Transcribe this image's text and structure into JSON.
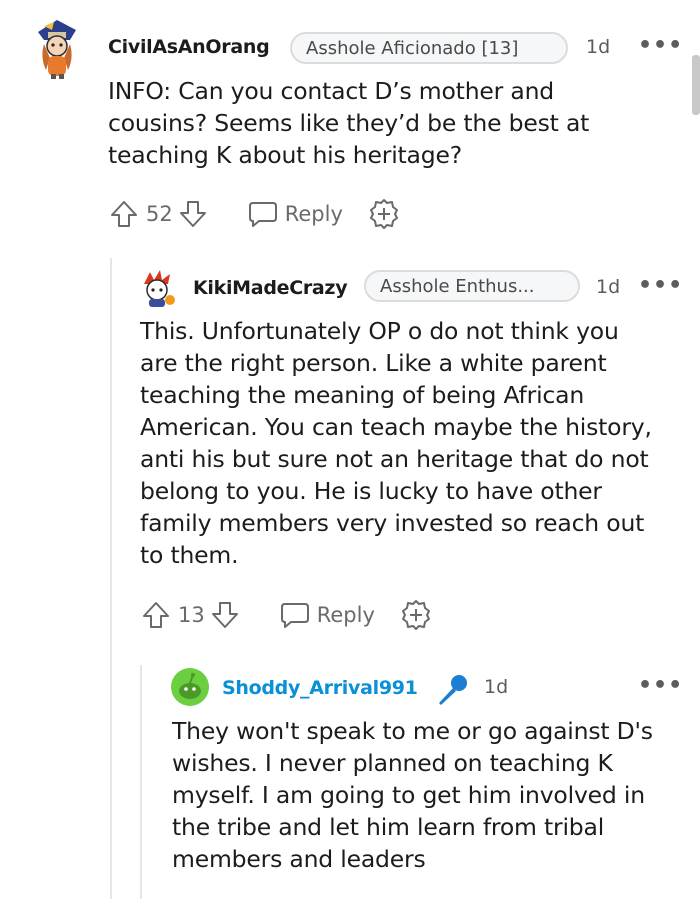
{
  "comments": [
    {
      "username": "CivilAsAnOrang",
      "flair": "Asshole Aficionado [13]",
      "time": "1d",
      "more": "•••",
      "lines": [
        "INFO: Can you contact D’s mother and",
        "cousins? Seems like they’d be the best at",
        "teaching K about his heritage?"
      ],
      "votes": "52",
      "reply_label": "Reply"
    },
    {
      "username": "KikiMadeCrazy",
      "flair": "Asshole Enthus...",
      "time": "1d",
      "more": "•••",
      "lines": [
        "This. Unfortunately OP o do not think you",
        "are the right person. Like a white parent",
        "teaching the meaning of being African",
        "American. You can teach maybe the history,",
        "anti his but sure not an heritage that do not",
        "belong to you. He is lucky to have other",
        "family members very invested so reach out",
        "to them."
      ],
      "votes": "13",
      "reply_label": "Reply"
    },
    {
      "username": "Shoddy_Arrival991",
      "time": "1d",
      "more": "•••",
      "lines": [
        "They won't speak to me or go against D's",
        "wishes. I never planned on teaching K",
        "myself. I am going to get him involved in",
        "the tribe and let him learn from tribal",
        "members and leaders"
      ]
    }
  ],
  "colors": {
    "op_username": "#0a90d8",
    "mic": "#1a7fd4",
    "avatar_green": "#6bcf3f"
  }
}
